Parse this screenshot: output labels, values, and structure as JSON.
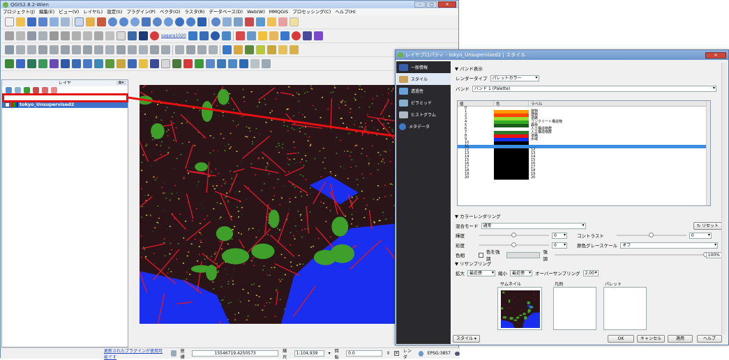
{
  "app": {
    "title": "QGIS2.8.2-Wien",
    "menus": [
      "プロジェクト(J)",
      "編集(E)",
      "ビュー(V)",
      "レイヤ(L)",
      "設定(S)",
      "プラグイン(P)",
      "ベクタ(O)",
      "ラスタ(R)",
      "データベース(D)",
      "Web(W)",
      "MMQGIS",
      "プロセッシング(C)",
      "ヘルプ(H)"
    ],
    "toolbar_link": "sagara1020"
  },
  "layers_panel": {
    "title": "レイヤ",
    "layer_name": "tokyo_Unsupervised2"
  },
  "status": {
    "plugin_link": "更新されたプラグインが使用可能です",
    "coord_label": "座標",
    "coord_value": "15546719,4250573",
    "scale_label": "縮尺",
    "scale_value": "1:104,939",
    "rotation_label": "回転",
    "rotation_value": "0.0",
    "render_label": "レンダ",
    "crs": "EPSG:3857"
  },
  "dialog": {
    "title": "レイヤプロパティ - tokyo_Unsupervised2 | スタイル",
    "sidebar": [
      {
        "label": "一般情報",
        "color": "#3a5ea8"
      },
      {
        "label": "スタイル",
        "color": "#c8a060"
      },
      {
        "label": "透過性",
        "color": "#6aa0d8"
      },
      {
        "label": "ピラミッド",
        "color": "#8ab0d0"
      },
      {
        "label": "ヒストグラム",
        "color": "#b0b8c8"
      },
      {
        "label": "メタデータ",
        "color": "#3a78c8"
      }
    ],
    "band_section": "バンド表示",
    "render_type_label": "レンダータイプ",
    "render_type_value": "パレットカラー",
    "band_label": "バンド",
    "band_value": "バンド 1 (Palette)",
    "table_headers": [
      "値",
      "色",
      "ラベル"
    ],
    "rows": [
      {
        "value": "0",
        "color": "#ffffff",
        "label": ""
      },
      {
        "value": "1",
        "color": "#ff9900",
        "label": "建物"
      },
      {
        "value": "2",
        "color": "#ff4400",
        "label": "建物"
      },
      {
        "value": "3",
        "color": "#99dd33",
        "label": "道路"
      },
      {
        "value": "4",
        "color": "#33aa22",
        "label": "コンクリート構造物"
      },
      {
        "value": "5",
        "color": "#1a5a1a",
        "label": "森林"
      },
      {
        "value": "6",
        "color": "#ffffff",
        "label": "人工構造物群"
      },
      {
        "value": "7",
        "color": "#2a7a2a",
        "label": "人工構造物群"
      },
      {
        "value": "8",
        "color": "#ee1111",
        "label": "道路"
      },
      {
        "value": "9",
        "color": "#1133ee",
        "label": "水域"
      },
      {
        "value": "10",
        "color": "#000000",
        "label": ""
      },
      {
        "value": "11",
        "color": "#000000",
        "label": ""
      },
      {
        "value": "12",
        "color": "#000000",
        "label": "12"
      },
      {
        "value": "13",
        "color": "#000000",
        "label": "13"
      },
      {
        "value": "14",
        "color": "#000000",
        "label": "14"
      },
      {
        "value": "15",
        "color": "#000000",
        "label": "15"
      },
      {
        "value": "16",
        "color": "#000000",
        "label": "16"
      },
      {
        "value": "17",
        "color": "#000000",
        "label": "17"
      },
      {
        "value": "18",
        "color": "#000000",
        "label": "18"
      },
      {
        "value": "19",
        "color": "#000000",
        "label": "19"
      },
      {
        "value": "20",
        "color": "#000000",
        "label": "20"
      }
    ],
    "selected_row": 11,
    "color_render_section": "カラーレンダリング",
    "blend_mode_label": "混合モード",
    "blend_mode_value": "通常",
    "reset_button": "リセット",
    "brightness_label": "輝度",
    "brightness_value": "0",
    "contrast_label": "コントラスト",
    "contrast_value": "0",
    "saturation_label": "彩度",
    "saturation_value": "0",
    "grayscale_label": "原色グレースケール",
    "grayscale_value": "オフ",
    "hue_label": "色相",
    "colorize_label": "色を強調",
    "strength_label": "強調",
    "strength_value": "100%",
    "resampling_section": "リサンプリング",
    "zoom_in_label": "拡大",
    "zoom_in_value": "最近傍",
    "zoom_out_label": "縮小",
    "zoom_out_value": "最近傍",
    "oversampling_label": "オーバーサンプリング",
    "oversampling_value": "2.00",
    "thumbnail_label": "サムネイル",
    "legend_label": "凡例",
    "palette_label": "パレット",
    "style_button": "スタイル",
    "ok_button": "OK",
    "cancel_button": "キャンセル",
    "apply_button": "適用",
    "help_button": "ヘルプ"
  },
  "colors": {
    "highlight": "#e21212",
    "selection": "#3a8fe0",
    "water": "#1a2ef0",
    "roads": "#d8192a",
    "forest": "#3ea02a"
  }
}
